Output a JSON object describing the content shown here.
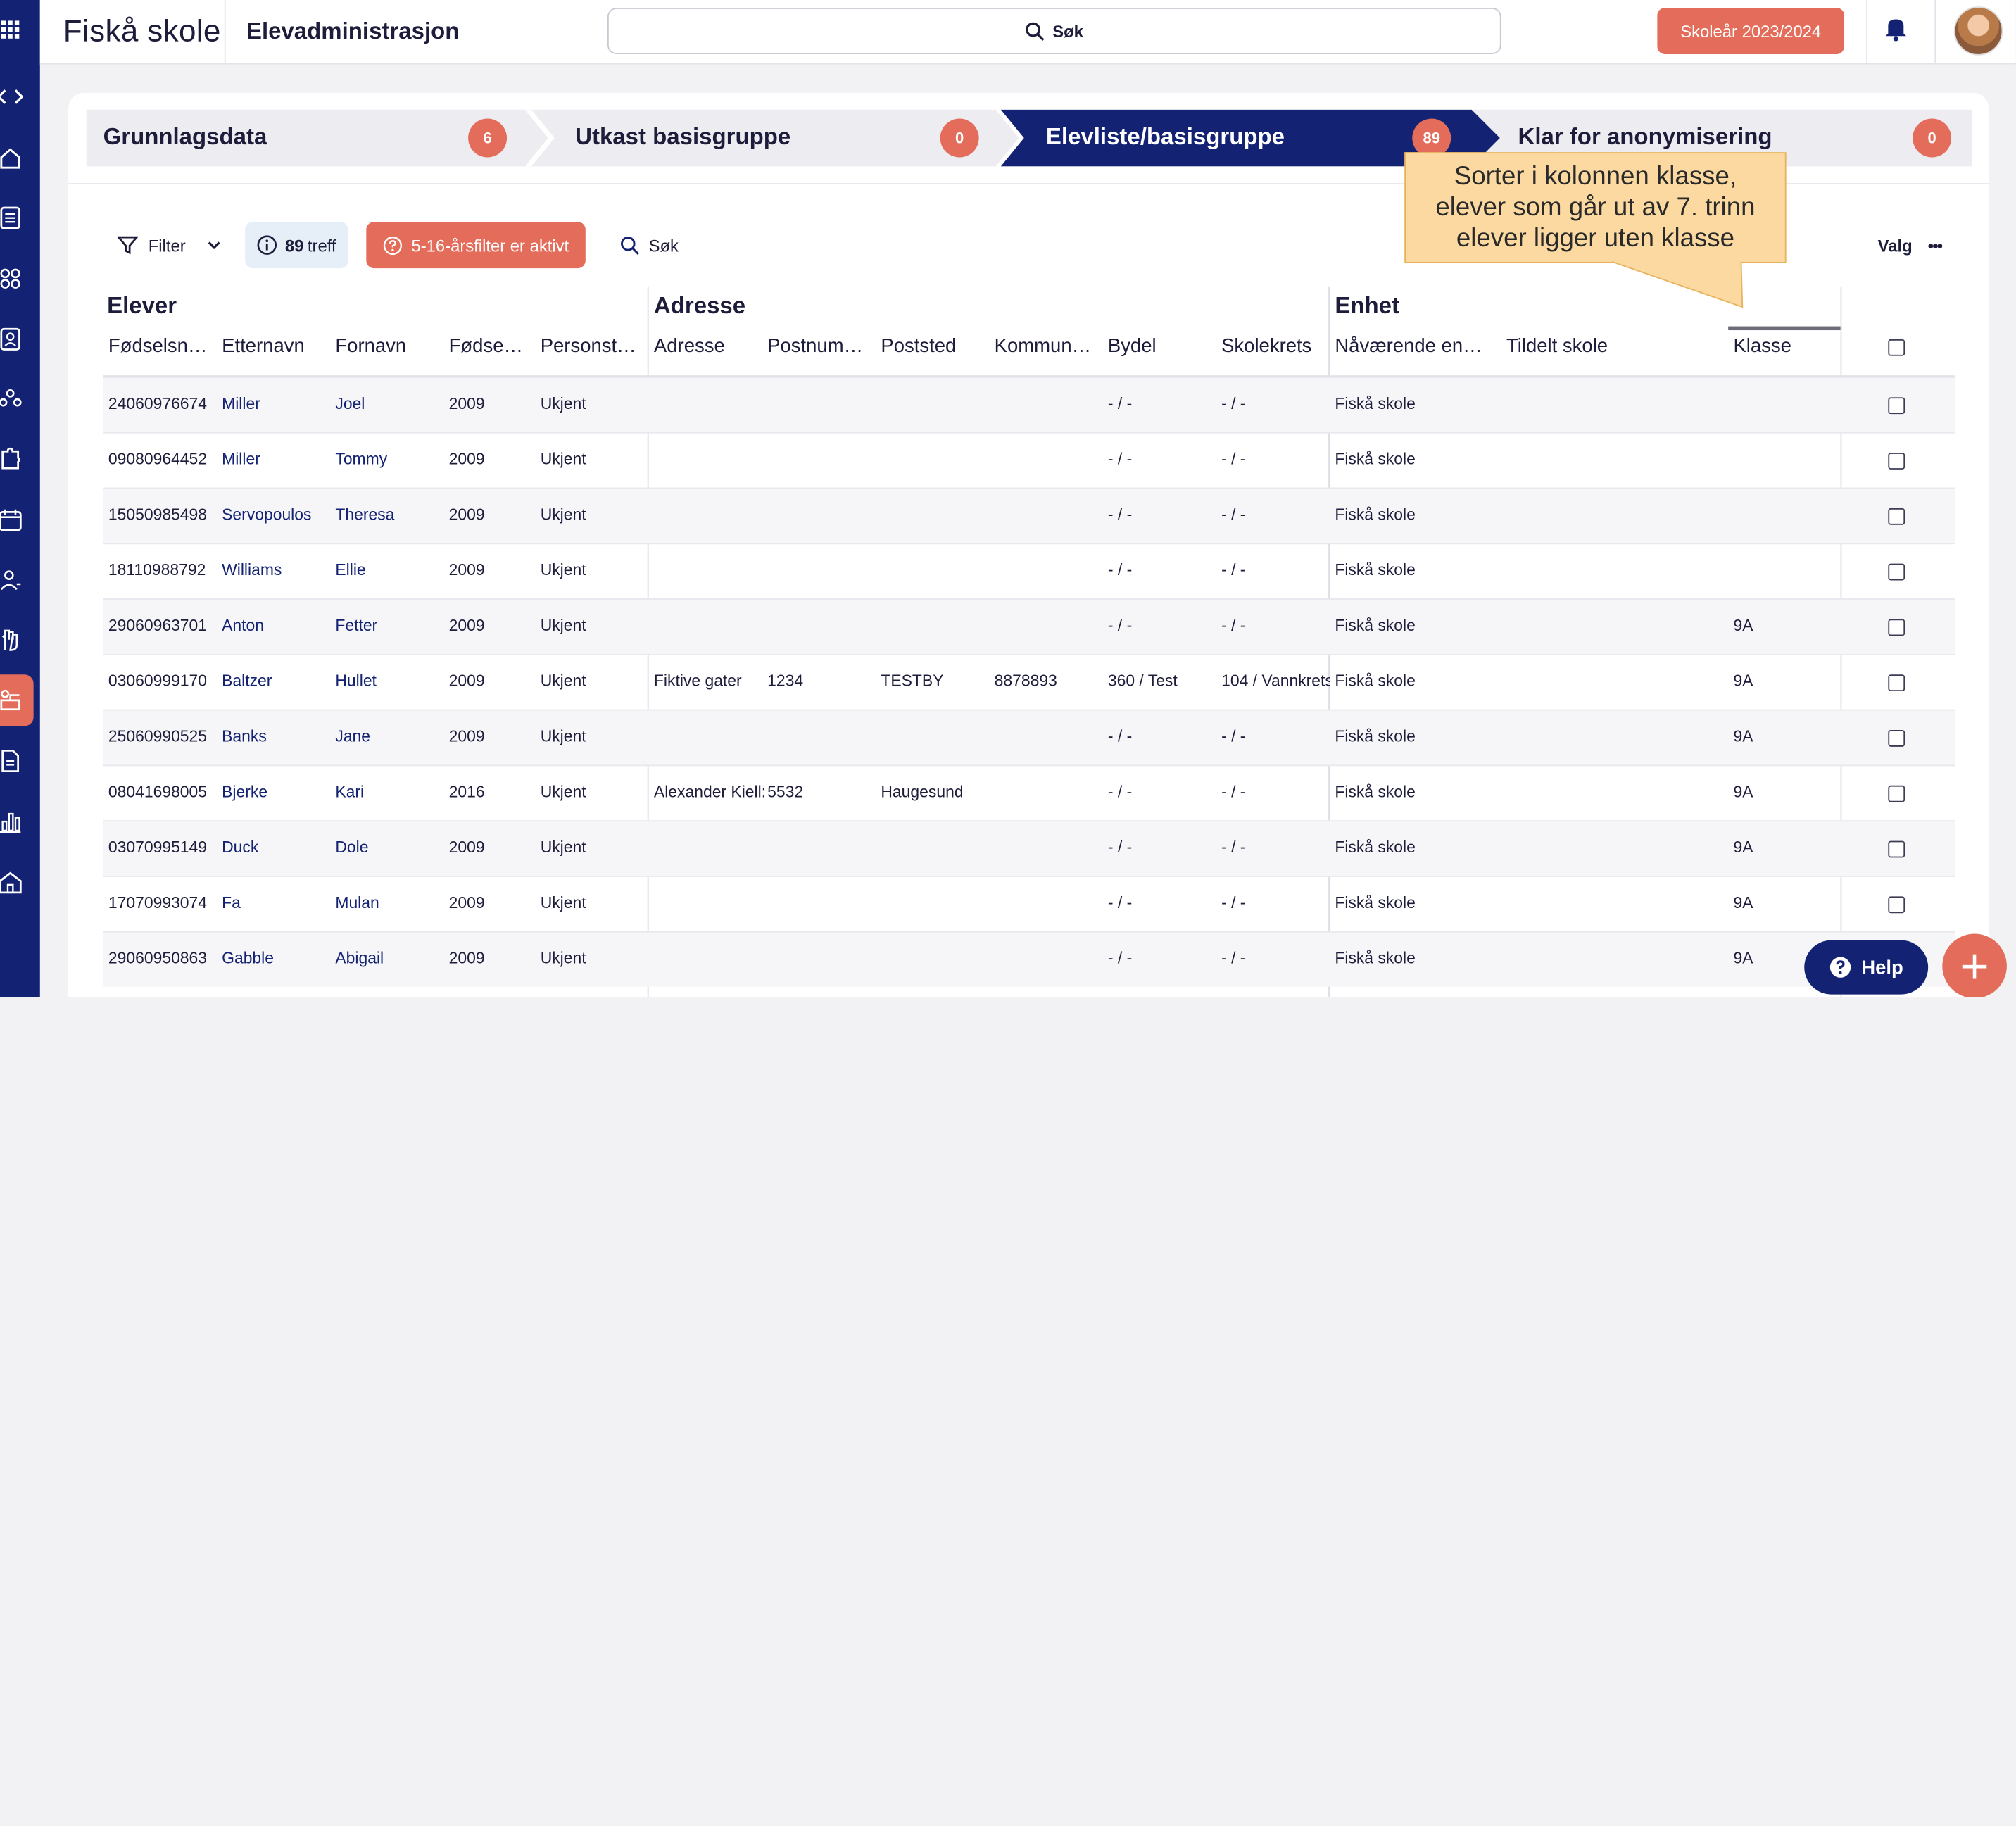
{
  "app": {
    "school_name": "Fiskå skole",
    "module_title": "Elevadministrasjon",
    "search_label": "Søk",
    "school_year": "Skoleår 2023/2024"
  },
  "sidebar": {
    "icons": [
      "grid-icon",
      "collapse-expand-icon",
      "home-icon",
      "list-icon",
      "group-icon",
      "id-card-icon",
      "people-network-icon",
      "puzzle-icon",
      "calendar-icon",
      "person-rotate-icon",
      "hand-icon",
      "classroom-icon",
      "document-icon",
      "bar-chart-icon",
      "school-building-icon"
    ],
    "active_index": 11
  },
  "steps": [
    {
      "label": "Grunnlagsdata",
      "count": "6",
      "active": false
    },
    {
      "label": "Utkast basisgruppe",
      "count": "0",
      "active": false
    },
    {
      "label": "Elevliste/basisgruppe",
      "count": "89",
      "active": true
    },
    {
      "label": "Klar for anonymisering",
      "count": "0",
      "active": false
    }
  ],
  "toolbar": {
    "filter_label": "Filter",
    "hits_count": "89",
    "hits_label": "treff",
    "age_filter_label": "5-16-årsfilter er aktivt",
    "search_label": "Søk",
    "options_label": "Valg"
  },
  "tooltip": {
    "text": "Sorter i kolonnen klasse, elever som går ut av 7. trinn elever ligger uten klasse"
  },
  "table": {
    "groups": {
      "students": "Elever",
      "address": "Adresse",
      "unit": "Enhet"
    },
    "columns": [
      "Fødselsn…",
      "Etternavn",
      "Fornavn",
      "Fødse…",
      "Personst…",
      "Adresse",
      "Postnum…",
      "Poststed",
      "Kommun…",
      "Bydel",
      "Skolekrets",
      "Nåværende en…",
      "Tildelt skole",
      "Klasse"
    ],
    "rows": [
      [
        "24060976674",
        "Miller",
        "Joel",
        "2009",
        "Ukjent",
        "",
        "",
        "",
        "",
        "- / -",
        "- / -",
        "Fiskå skole",
        "",
        ""
      ],
      [
        "09080964452",
        "Miller",
        "Tommy",
        "2009",
        "Ukjent",
        "",
        "",
        "",
        "",
        "- / -",
        "- / -",
        "Fiskå skole",
        "",
        ""
      ],
      [
        "15050985498",
        "Servopoulos",
        "Theresa",
        "2009",
        "Ukjent",
        "",
        "",
        "",
        "",
        "- / -",
        "- / -",
        "Fiskå skole",
        "",
        ""
      ],
      [
        "18110988792",
        "Williams",
        "Ellie",
        "2009",
        "Ukjent",
        "",
        "",
        "",
        "",
        "- / -",
        "- / -",
        "Fiskå skole",
        "",
        ""
      ],
      [
        "29060963701",
        "Anton",
        "Fetter",
        "2009",
        "Ukjent",
        "",
        "",
        "",
        "",
        "- / -",
        "- / -",
        "Fiskå skole",
        "",
        "9A"
      ],
      [
        "03060999170",
        "Baltzer",
        "Hullet",
        "2009",
        "Ukjent",
        "Fiktive gater",
        "1234",
        "TESTBY",
        "8878893",
        "360 / Test",
        "104 / Vannkrets",
        "Fiskå skole",
        "",
        "9A"
      ],
      [
        "25060990525",
        "Banks",
        "Jane",
        "2009",
        "Ukjent",
        "",
        "",
        "",
        "",
        "- / -",
        "- / -",
        "Fiskå skole",
        "",
        "9A"
      ],
      [
        "08041698005",
        "Bjerke",
        "Kari",
        "2016",
        "Ukjent",
        "Alexander Kiell:",
        "5532",
        "Haugesund",
        "",
        "- / -",
        "- / -",
        "Fiskå skole",
        "",
        "9A"
      ],
      [
        "03070995149",
        "Duck",
        "Dole",
        "2009",
        "Ukjent",
        "",
        "",
        "",
        "",
        "- / -",
        "- / -",
        "Fiskå skole",
        "",
        "9A"
      ],
      [
        "17070993074",
        "Fa",
        "Mulan",
        "2009",
        "Ukjent",
        "",
        "",
        "",
        "",
        "- / -",
        "- / -",
        "Fiskå skole",
        "",
        "9A"
      ],
      [
        "29060950863",
        "Gabble",
        "Abigail",
        "2009",
        "Ukjent",
        "",
        "",
        "",
        "",
        "- / -",
        "- / -",
        "Fiskå skole",
        "",
        "9A"
      ]
    ]
  },
  "help_label": "Help",
  "colors": {
    "navy": "#132272",
    "accent": "#e36d5a",
    "tooltip": "#fbd9a0"
  }
}
